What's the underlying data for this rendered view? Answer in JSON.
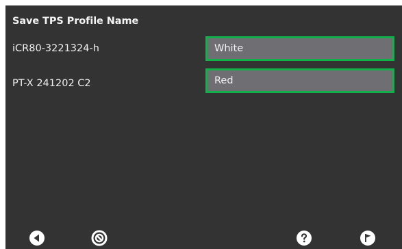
{
  "dialog": {
    "title": "Save TPS Profile Name"
  },
  "rows": [
    {
      "label": "iCR80-3221324-h",
      "value": "White"
    },
    {
      "label": "PT-X 241202 C2",
      "value": "Red"
    }
  ],
  "toolbar": {
    "back_icon": "back-arrow-icon",
    "cancel_icon": "cancel-icon",
    "help_icon": "help-icon",
    "finish_icon": "finish-flag-icon"
  },
  "colors": {
    "background": "#333333",
    "field_fill": "#6e6e73",
    "field_border": "#12b04a",
    "text": "#f2f2f2"
  }
}
